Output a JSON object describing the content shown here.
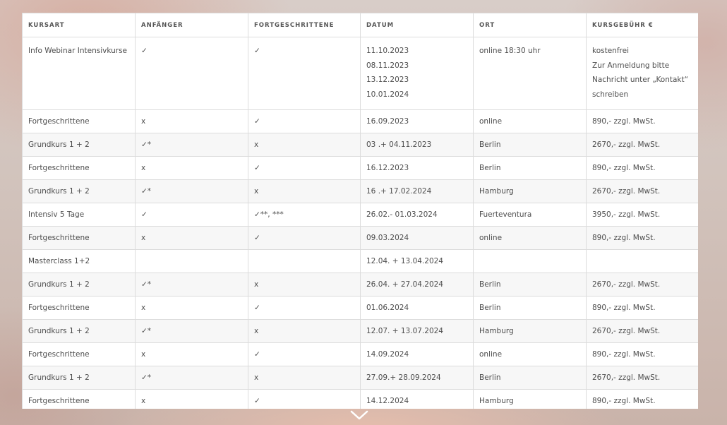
{
  "table": {
    "headers": [
      "KURSART",
      "ANFÄNGER",
      "FORTGESCHRITTENE",
      "DATUM",
      "ORT",
      "KURSGEBÜHR €"
    ],
    "first_row": {
      "kursart": "Info Webinar Intensivkurse",
      "anfaenger": "✓",
      "fortgeschrittene": "✓",
      "datum_lines": [
        "11.10.2023",
        "08.11.2023",
        "13.12.2023",
        "10.01.2024"
      ],
      "ort": "online 18:30 uhr",
      "gebuehr_lines": [
        "kostenfrei",
        "Zur Anmeldung bitte",
        "Nachricht unter „Kontakt“",
        "schreiben"
      ]
    },
    "rows": [
      [
        "Fortgeschrittene",
        "x",
        "✓",
        "16.09.2023",
        "online",
        "890,- zzgl. MwSt."
      ],
      [
        "Grundkurs 1 + 2",
        "✓*",
        "x",
        "03 .+ 04.11.2023",
        "Berlin",
        "2670,- zzgl. MwSt."
      ],
      [
        "Fortgeschrittene",
        "x",
        "✓",
        "16.12.2023",
        "Berlin",
        "890,- zzgl. MwSt."
      ],
      [
        "Grundkurs 1 + 2",
        "✓*",
        "x",
        "16 .+ 17.02.2024",
        "Hamburg",
        "2670,- zzgl. MwSt."
      ],
      [
        "Intensiv 5 Tage",
        "✓",
        "✓**, ***",
        "26.02.- 01.03.2024",
        "Fuerteventura",
        "3950,- zzgl. MwSt."
      ],
      [
        "Fortgeschrittene",
        "x",
        "✓",
        "09.03.2024",
        "online",
        "890,- zzgl. MwSt."
      ],
      [
        "Masterclass 1+2",
        "",
        "",
        "12.04. + 13.04.2024",
        "",
        ""
      ],
      [
        "Grundkurs 1 + 2",
        "✓*",
        "x",
        "26.04. + 27.04.2024",
        "Berlin",
        "2670,- zzgl. MwSt."
      ],
      [
        "Fortgeschrittene",
        "x",
        "✓",
        "01.06.2024",
        "Berlin",
        "890,- zzgl. MwSt."
      ],
      [
        "Grundkurs 1 + 2",
        "✓*",
        "x",
        "12.07. + 13.07.2024",
        "Hamburg",
        "2670,- zzgl. MwSt."
      ],
      [
        "Fortgeschrittene",
        "x",
        "✓",
        "14.09.2024",
        "online",
        "890,- zzgl. MwSt."
      ],
      [
        "Grundkurs 1 + 2",
        "✓*",
        "x",
        "27.09.+ 28.09.2024",
        "Berlin",
        "2670,- zzgl. MwSt."
      ],
      [
        "Fortgeschrittene",
        "x",
        "✓",
        "14.12.2024",
        "Hamburg",
        "890,- zzgl. MwSt."
      ]
    ]
  },
  "scroll_down_icon": "chevron-down-icon",
  "colors": {
    "text": "#4d4d4d",
    "border": "#dcdcdc",
    "row_alt": "#f7f7f7",
    "table_bg": "#ffffff"
  }
}
